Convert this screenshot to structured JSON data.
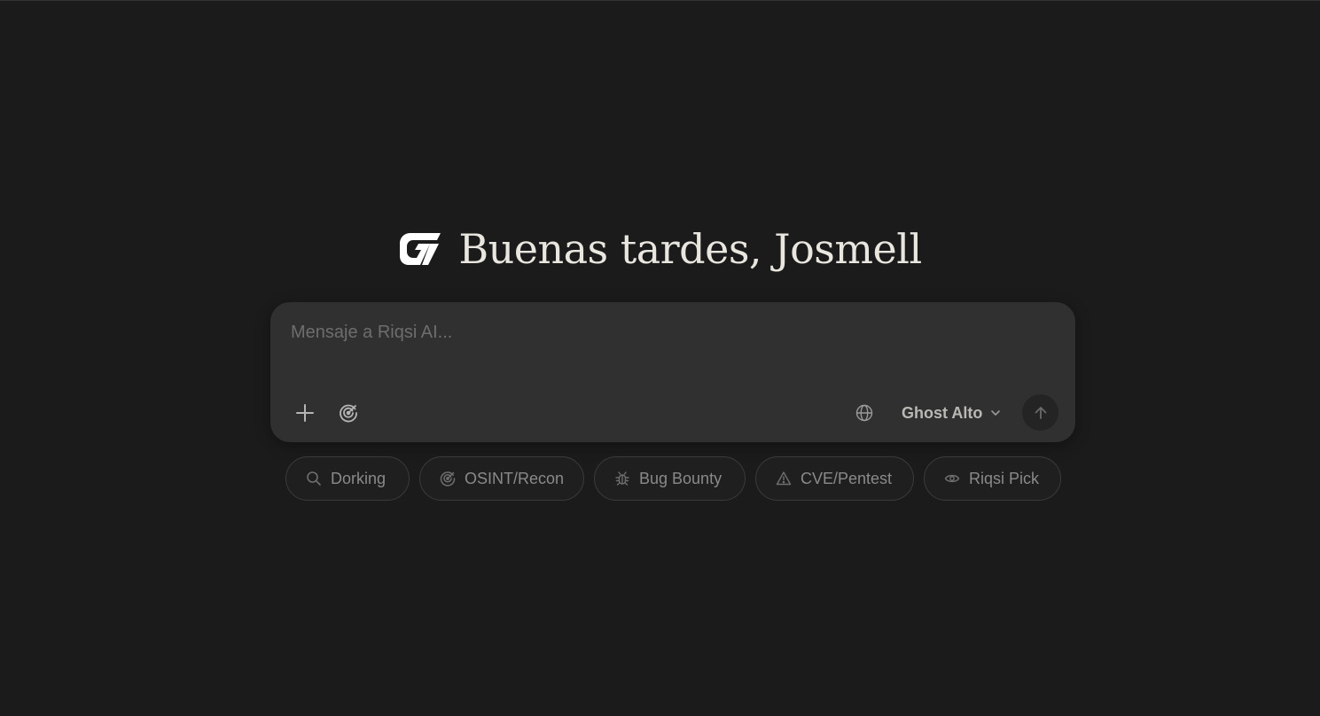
{
  "greeting": {
    "text": "Buenas tardes, Josmell",
    "logo_icon": "brand-logo-icon"
  },
  "composer": {
    "placeholder": "Mensaje a Riqsi AI...",
    "value": "",
    "attach_icon": "plus-icon",
    "mode_icon": "radar-icon",
    "web_icon": "globe-icon",
    "model_label": "Ghost Alto",
    "model_caret_icon": "chevron-down-icon",
    "send_icon": "arrow-up-icon"
  },
  "chips": [
    {
      "label": "Dorking",
      "icon": "search-icon"
    },
    {
      "label": "OSINT/Recon",
      "icon": "radar-icon"
    },
    {
      "label": "Bug Bounty",
      "icon": "bug-icon"
    },
    {
      "label": "CVE/Pentest",
      "icon": "warning-icon"
    },
    {
      "label": "Riqsi Pick",
      "icon": "eye-icon"
    }
  ],
  "colors": {
    "background": "#1b1b1b",
    "composer_bg": "#303030",
    "chip_border": "#3b3b3b",
    "placeholder": "#6d6d6d",
    "chip_text": "#8a8a8a"
  }
}
